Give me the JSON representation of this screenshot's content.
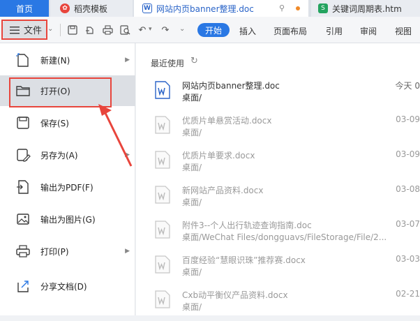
{
  "tabs": [
    {
      "label": "首页"
    },
    {
      "label": "稻壳模板"
    },
    {
      "label": "网站内页banner整理.doc"
    },
    {
      "label": "关键词周期表.htm"
    }
  ],
  "toolbar": {
    "file_label": "文件",
    "start_label": "开始",
    "menus": [
      "插入",
      "页面布局",
      "引用",
      "审阅",
      "视图"
    ]
  },
  "sidebar": {
    "items": [
      {
        "label": "新建(N)",
        "icon": "new-icon"
      },
      {
        "label": "打开(O)",
        "icon": "folder-icon"
      },
      {
        "label": "保存(S)",
        "icon": "save-icon"
      },
      {
        "label": "另存为(A)",
        "icon": "save-as-icon"
      },
      {
        "label": "输出为PDF(F)",
        "icon": "pdf-export-icon"
      },
      {
        "label": "输出为图片(G)",
        "icon": "image-export-icon"
      },
      {
        "label": "打印(P)",
        "icon": "print-icon"
      },
      {
        "label": "分享文档(D)",
        "icon": "share-icon"
      }
    ]
  },
  "recent": {
    "title": "最近使用",
    "files": [
      {
        "name": "网站内页banner整理.doc",
        "path": "桌面/",
        "date": "今天 0"
      },
      {
        "name": "优质片单悬赏活动.docx",
        "path": "桌面/",
        "date": "03-09"
      },
      {
        "name": "优质片单要求.docx",
        "path": "桌面/",
        "date": "03-09"
      },
      {
        "name": "新网站产品资料.docx",
        "path": "桌面/",
        "date": "03-08"
      },
      {
        "name": "附件3--个人出行轨迹查询指南.doc",
        "path": "桌面/WeChat Files/dongguavs/FileStorage/File/2...",
        "date": "03-07"
      },
      {
        "name": "百度经验“慧眼识珠”推荐赛.docx",
        "path": "桌面/",
        "date": "03-03"
      },
      {
        "name": "Cxb动平衡仪产品资料.docx",
        "path": "桌面/",
        "date": "02-21"
      }
    ]
  },
  "colors": {
    "accent": "#2a78e4",
    "highlight": "#e8453c",
    "word_blue": "#2a64c8"
  }
}
